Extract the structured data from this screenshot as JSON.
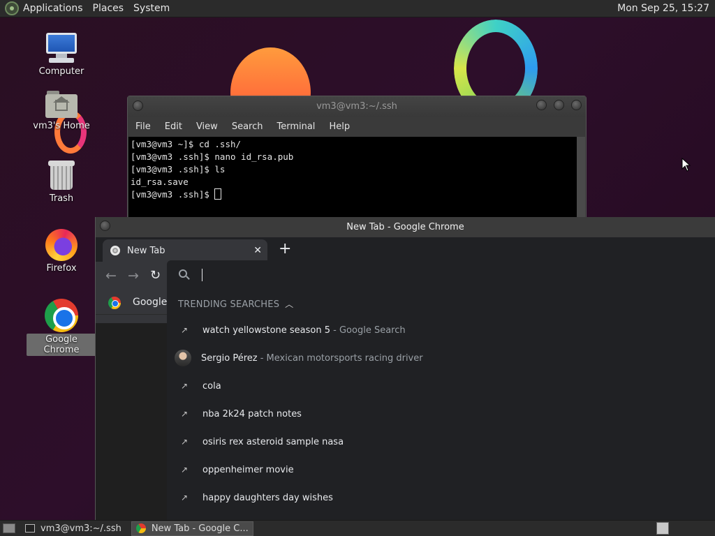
{
  "top_panel": {
    "menus": [
      "Applications",
      "Places",
      "System"
    ],
    "clock": "Mon Sep 25, 15:27"
  },
  "desktop_icons": [
    {
      "label": "Computer",
      "icon": "computer-icon"
    },
    {
      "label": "vm3's Home",
      "icon": "home-folder-icon"
    },
    {
      "label": "Trash",
      "icon": "trash-icon"
    },
    {
      "label": "Firefox",
      "icon": "firefox-icon"
    },
    {
      "label": "Google Chrome",
      "icon": "chrome-icon"
    }
  ],
  "terminal": {
    "title": "vm3@vm3:~/.ssh",
    "menus": [
      "File",
      "Edit",
      "View",
      "Search",
      "Terminal",
      "Help"
    ],
    "lines": [
      "[vm3@vm3 ~]$ cd .ssh/",
      "[vm3@vm3 .ssh]$ nano id_rsa.pub",
      "[vm3@vm3 .ssh]$ ls",
      "id_rsa.save"
    ],
    "prompt": "[vm3@vm3 .ssh]$ "
  },
  "chrome": {
    "title": "New Tab - Google Chrome",
    "tab_title": "New Tab",
    "tab_close": "✕",
    "new_tab": "+",
    "bookmark_label": "Google C",
    "omnibox_value": "",
    "trending_header": "TRENDING SEARCHES",
    "suggestions": [
      {
        "main": "watch yellowstone season 5",
        "sub": " - Google Search",
        "icon": "trending-icon"
      },
      {
        "main": "Sergio Pérez",
        "sub": " - Mexican motorsports racing driver",
        "icon": "avatar-icon"
      },
      {
        "main": "cola",
        "sub": "",
        "icon": "trending-icon"
      },
      {
        "main": "nba 2k24 patch notes",
        "sub": "",
        "icon": "trending-icon"
      },
      {
        "main": "osiris rex asteroid sample nasa",
        "sub": "",
        "icon": "trending-icon"
      },
      {
        "main": "oppenheimer movie",
        "sub": "",
        "icon": "trending-icon"
      },
      {
        "main": "happy daughters day wishes",
        "sub": "",
        "icon": "trending-icon"
      }
    ]
  },
  "taskbar": {
    "tasks": [
      "vm3@vm3:~/.ssh",
      "New Tab - Google C..."
    ]
  }
}
